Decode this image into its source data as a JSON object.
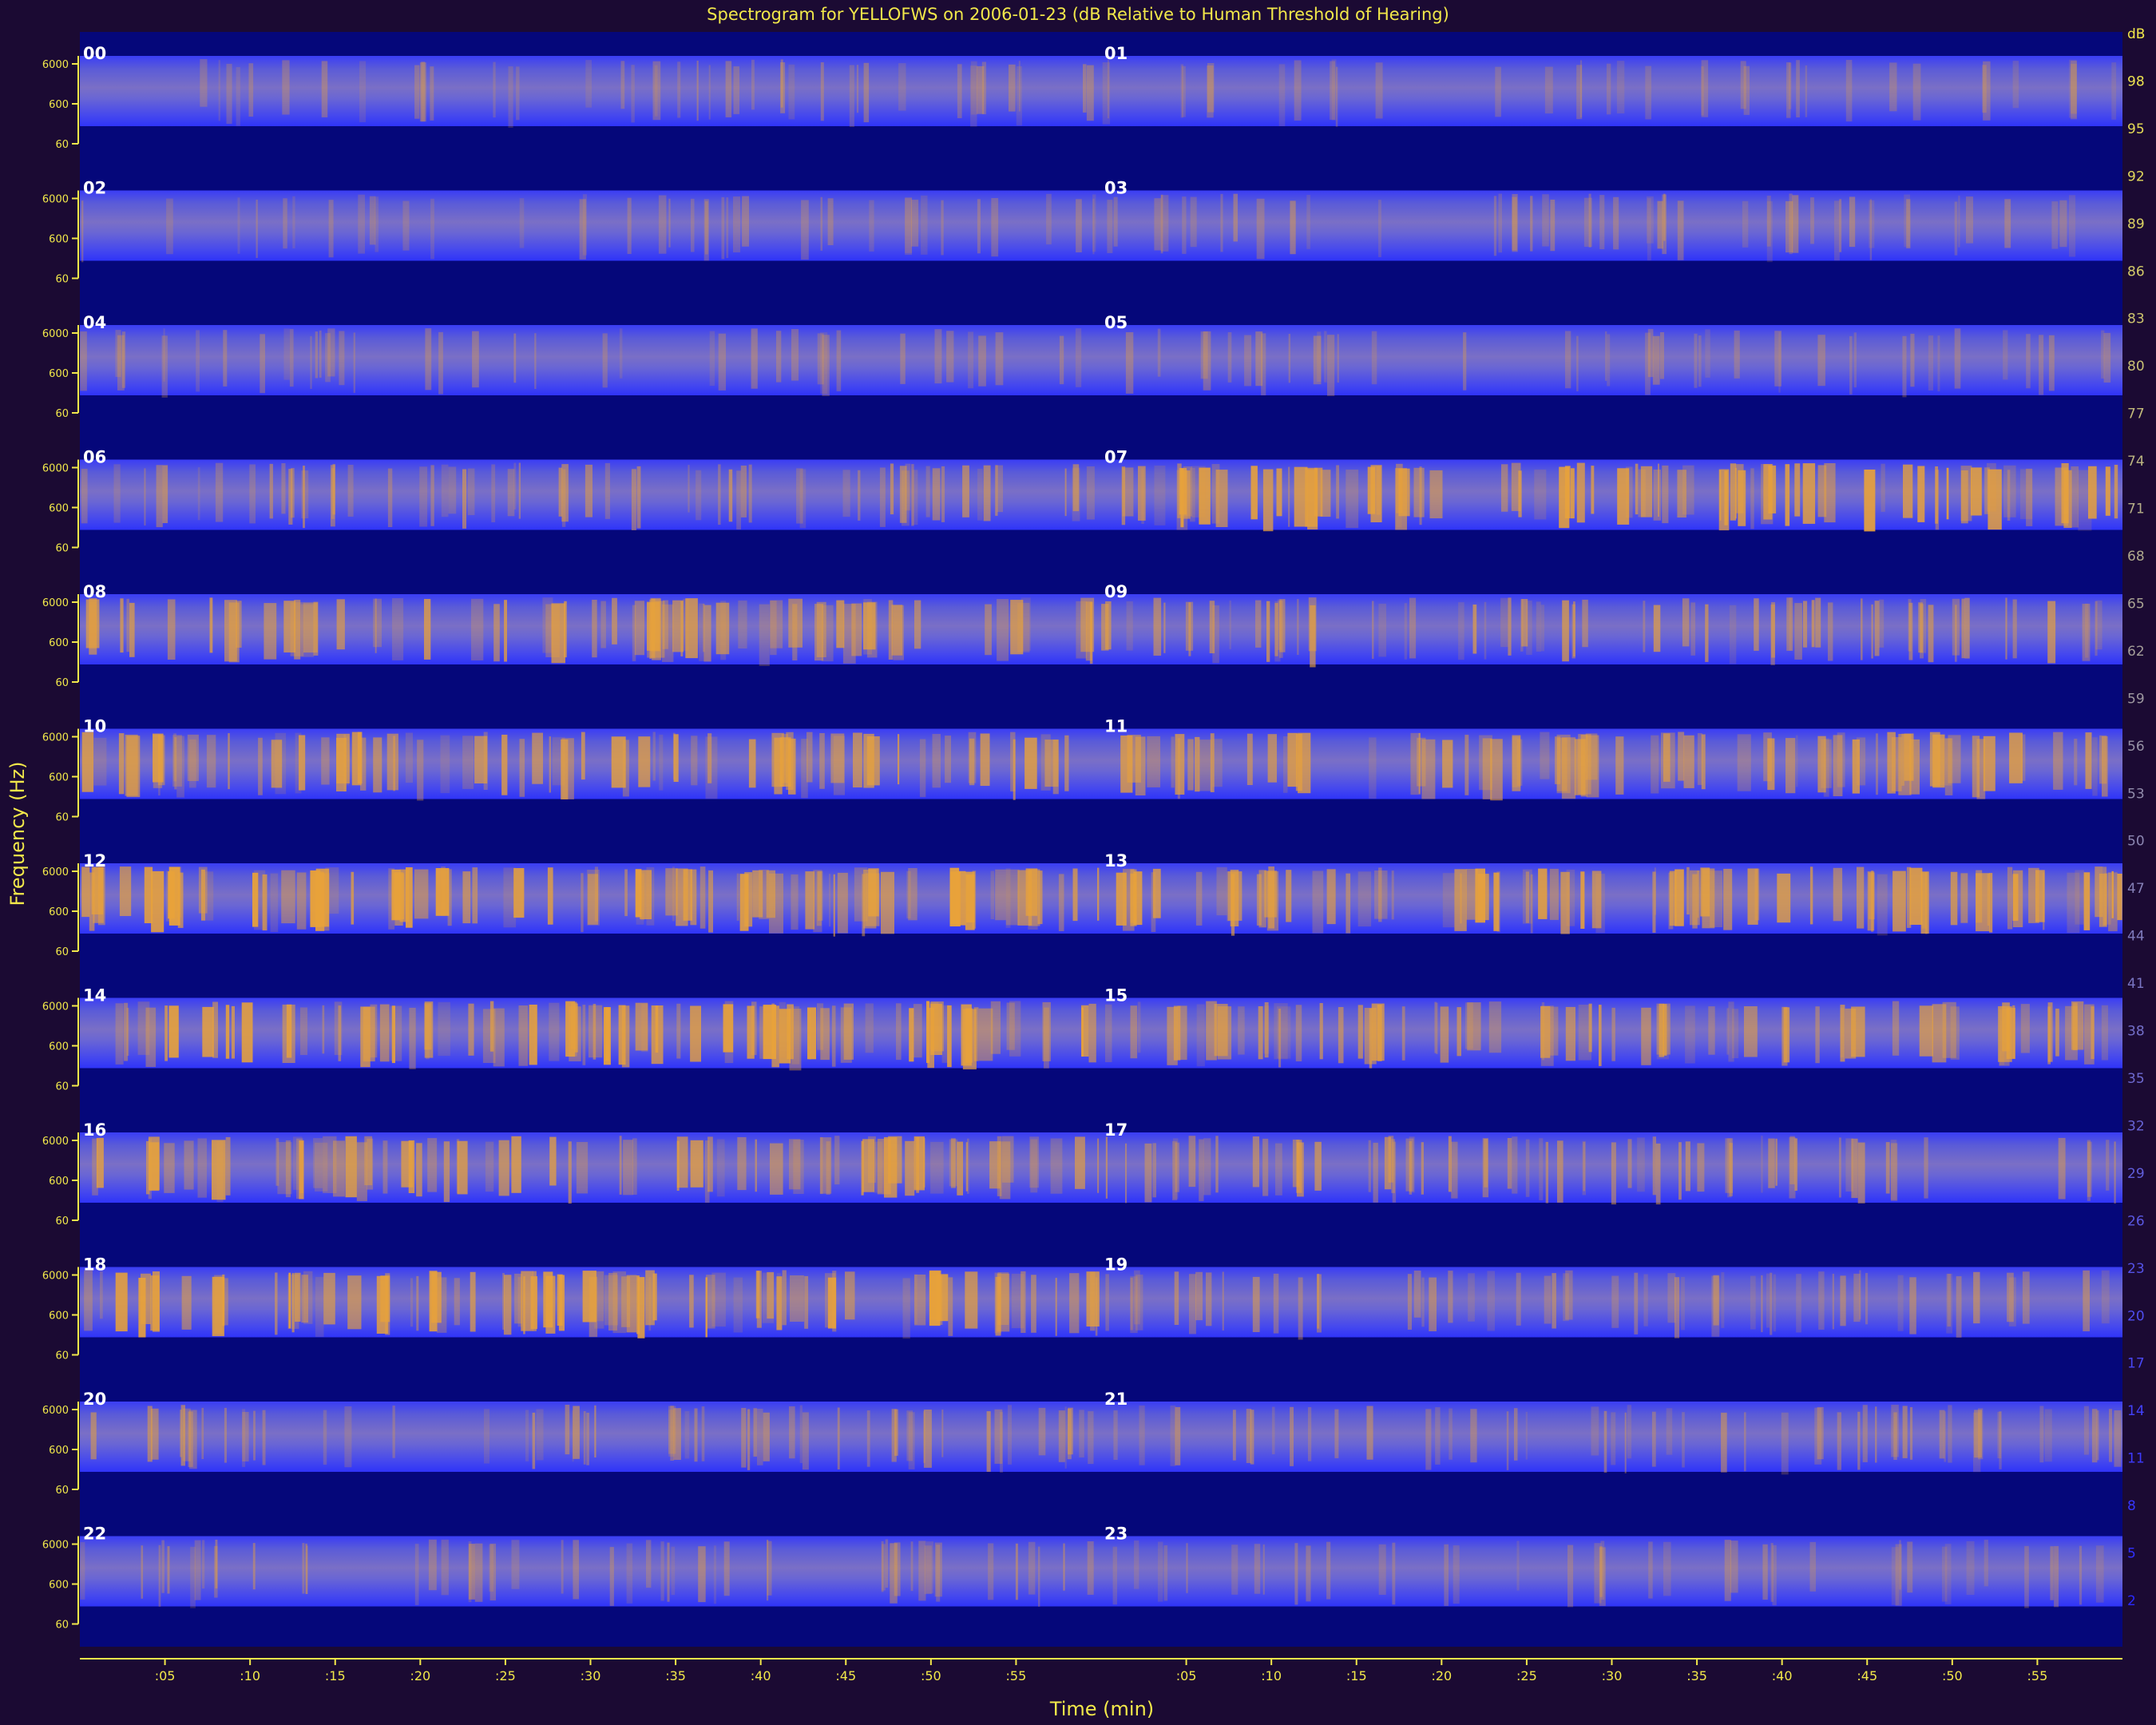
{
  "chart_data": {
    "type": "heatmap",
    "title": "Spectrogram for YELLOFWS on 2006-01-23 (dB Relative to Human Threshold of Hearing)",
    "xlabel": "Time (min)",
    "ylabel": "Frequency (Hz)",
    "rows": [
      "00",
      "01",
      "02",
      "03",
      "04",
      "05",
      "06",
      "07",
      "08",
      "09",
      "10",
      "11",
      "12",
      "13",
      "14",
      "15",
      "16",
      "17",
      "18",
      "19",
      "20",
      "21",
      "22",
      "23"
    ],
    "frequency_ticks": [
      "6000",
      "600",
      "60"
    ],
    "time_ticks": [
      ":05",
      ":10",
      ":15",
      ":20",
      ":25",
      ":30",
      ":35",
      ":40",
      ":45",
      ":50",
      ":55"
    ],
    "db_scale": [
      "dB",
      "98",
      "95",
      "92",
      "89",
      "86",
      "83",
      "80",
      "77",
      "74",
      "71",
      "68",
      "65",
      "62",
      "59",
      "56",
      "53",
      "50",
      "47",
      "44",
      "41",
      "38",
      "35",
      "32",
      "29",
      "26",
      "23",
      "20",
      "17",
      "14",
      "11",
      "8",
      "5",
      "2"
    ],
    "hourly_activity": [
      0.22,
      0.15,
      0.18,
      0.28,
      0.2,
      0.22,
      0.42,
      0.7,
      0.55,
      0.5,
      0.6,
      0.58,
      0.75,
      0.68,
      0.72,
      0.55,
      0.6,
      0.45,
      0.7,
      0.35,
      0.38,
      0.32,
      0.3,
      0.2
    ],
    "colors": {
      "background": "#1b0a33",
      "plot": "#05077a",
      "band": "#3b3cf0",
      "hot": "#e8a23a",
      "text": "#f2e84a",
      "label": "#ffffff"
    }
  }
}
